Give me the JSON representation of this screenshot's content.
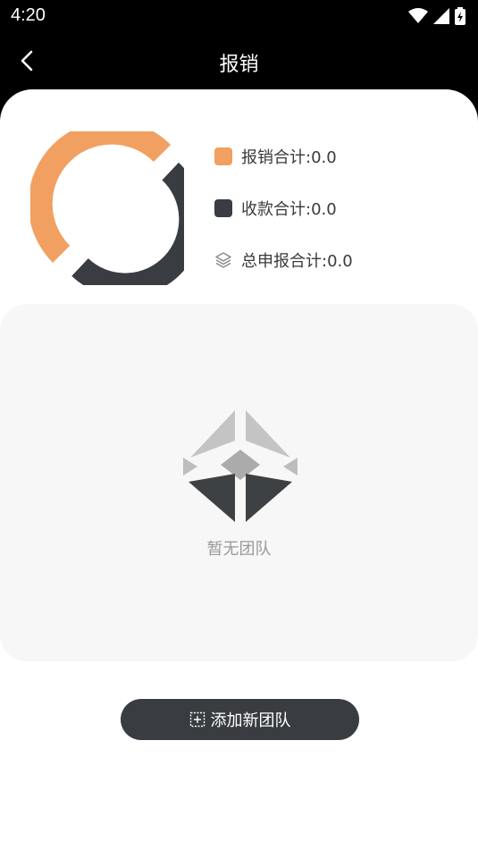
{
  "status_bar": {
    "time": "4:20",
    "icons": [
      "wifi-icon",
      "signal-icon",
      "battery-charging-icon"
    ]
  },
  "header": {
    "title": "报销",
    "back_icon": "chevron-left-icon"
  },
  "summary": {
    "items": [
      {
        "label": "报销合计:0.0",
        "swatch_color": "#F2A061"
      },
      {
        "label": "收款合计:0.0",
        "swatch_color": "#393C40"
      },
      {
        "label": "总申报合计:0.0",
        "icon": "layers-icon"
      }
    ]
  },
  "team_panel": {
    "empty_text": "暂无团队",
    "empty_icon": "empty-box-icon"
  },
  "actions": {
    "add_team_label": "添加新团队",
    "add_team_icon": "add-square-icon"
  },
  "colors": {
    "accent_orange": "#F2A061",
    "dark": "#393C40",
    "panel_bg": "#F7F7F7",
    "header_bg": "#000000"
  }
}
